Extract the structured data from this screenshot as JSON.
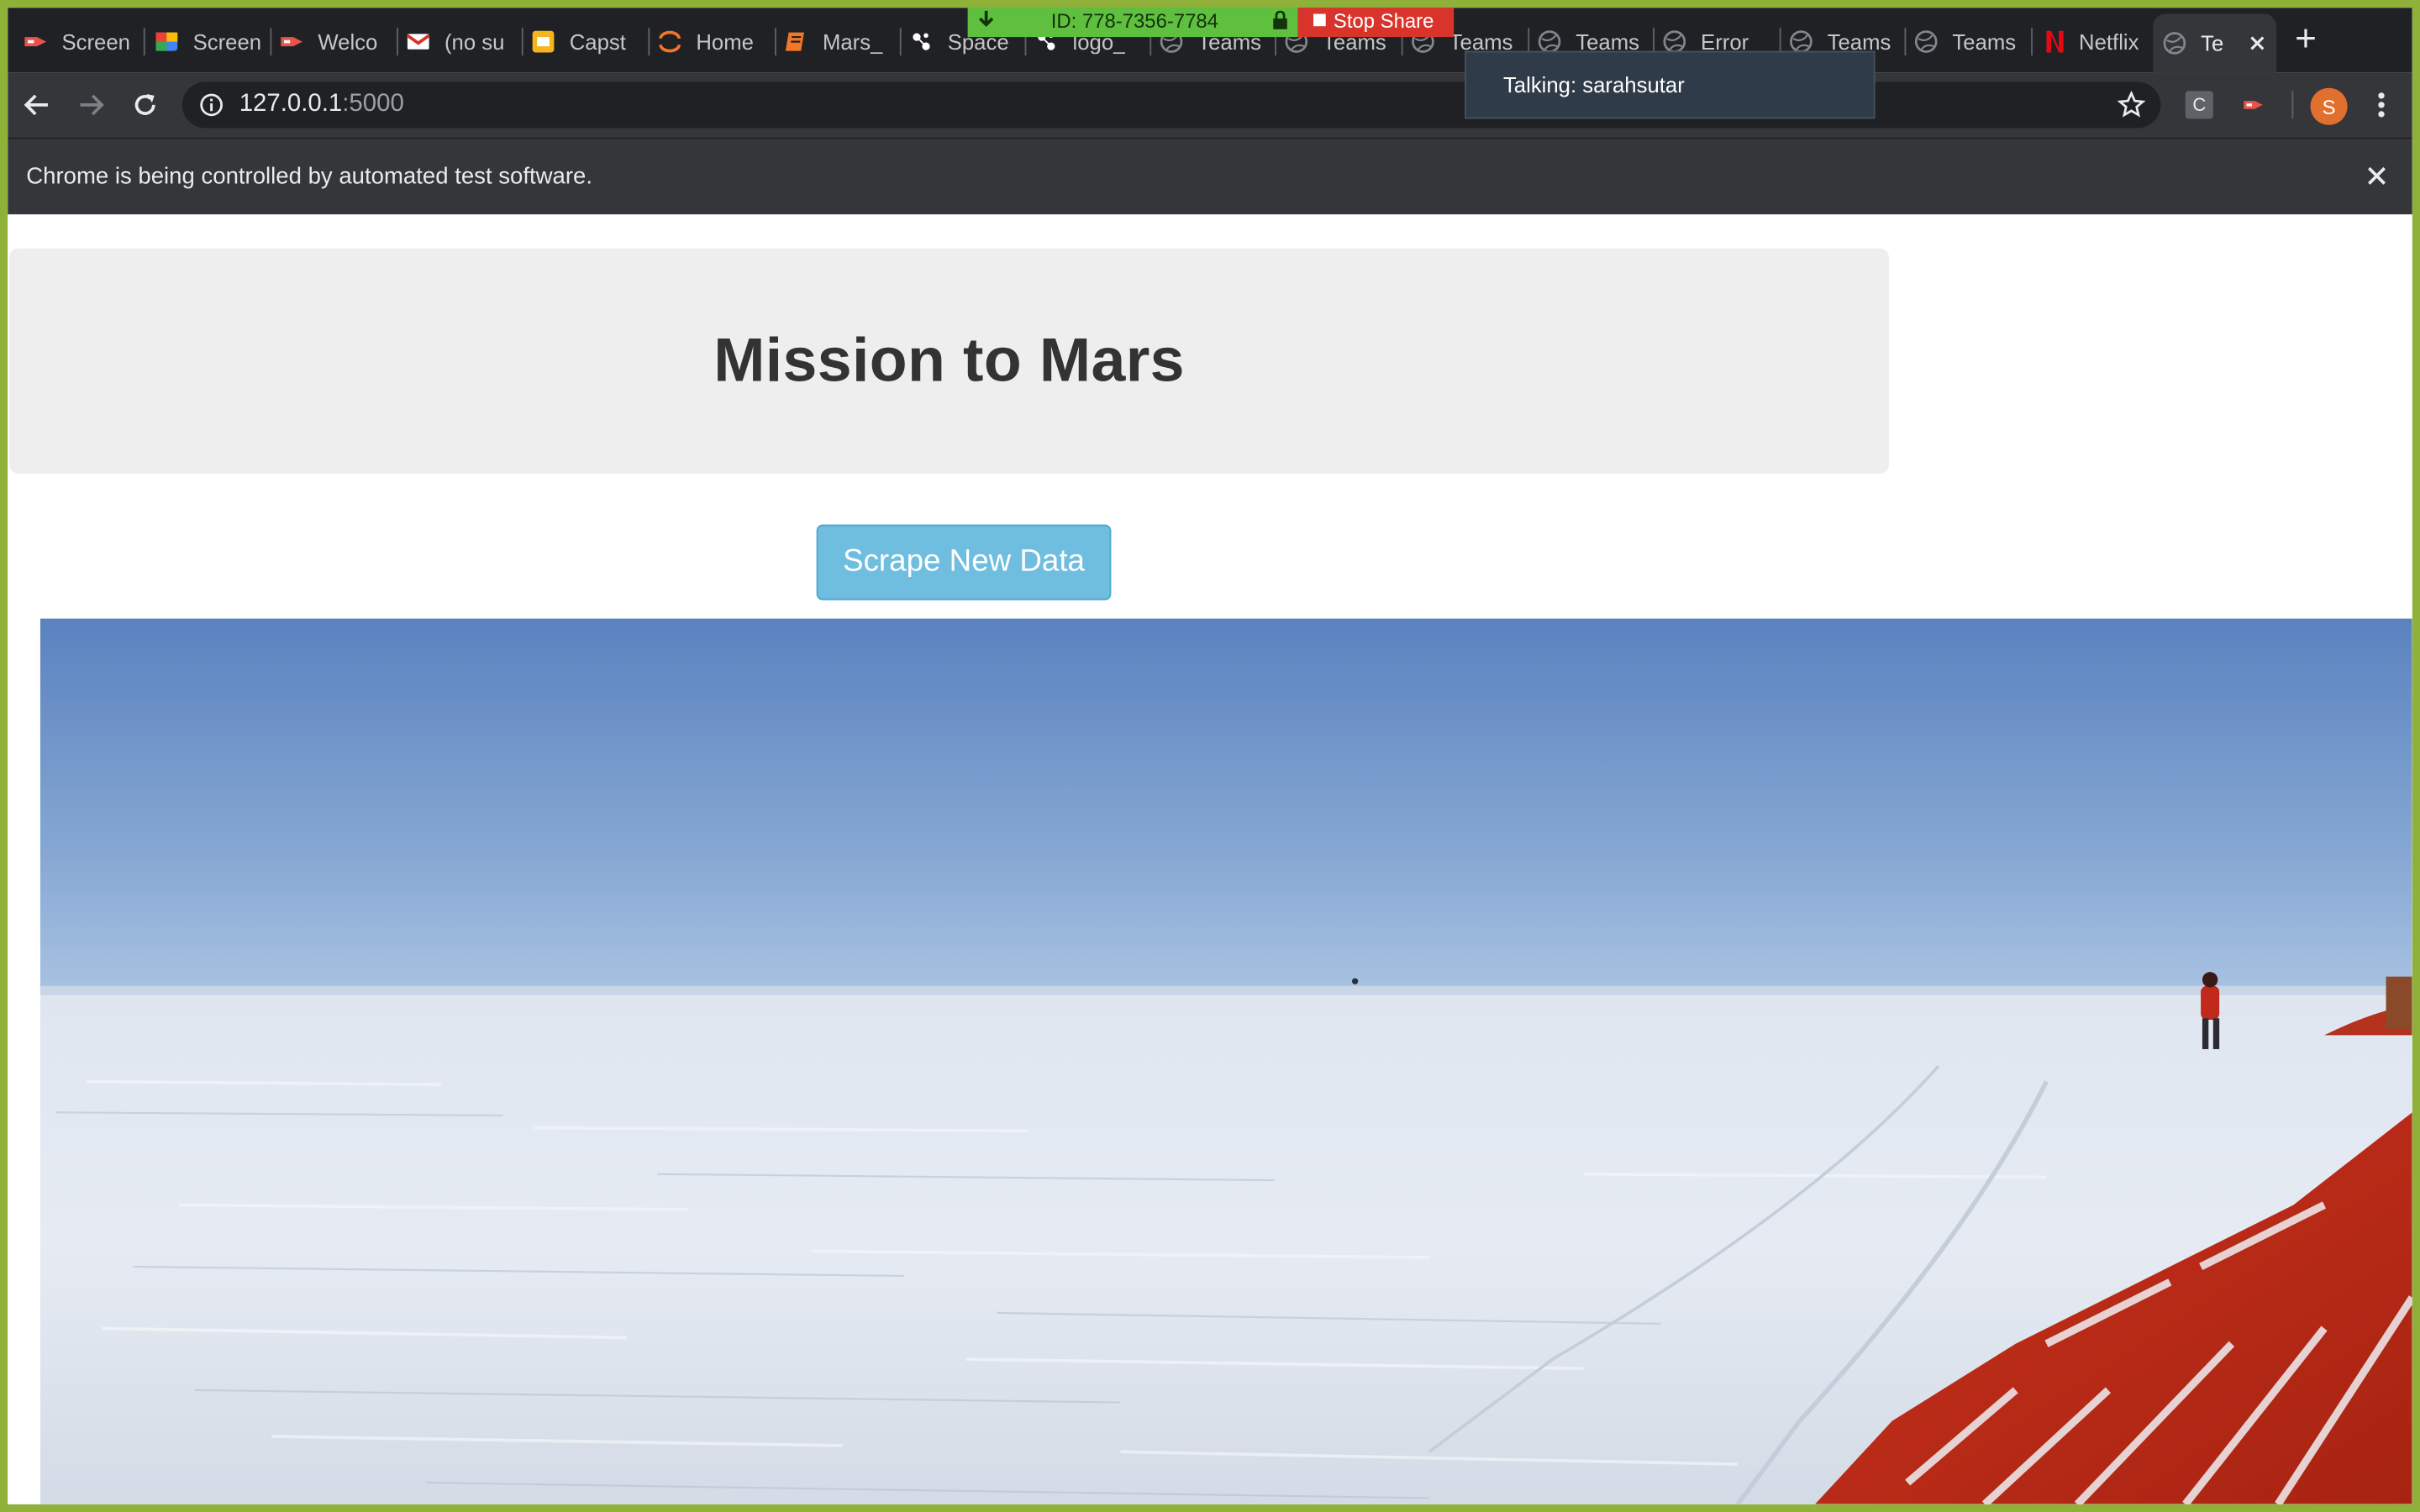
{
  "browser": {
    "tabs": [
      {
        "label": "Screen",
        "icon": "screencastify-icon",
        "color": "#e8534a"
      },
      {
        "label": "Screen",
        "icon": "drive-icon",
        "color": "#f4b400"
      },
      {
        "label": "Welco",
        "icon": "screencastify-icon",
        "color": "#e8534a"
      },
      {
        "label": "(no su",
        "icon": "gmail-icon",
        "color": "#d93025"
      },
      {
        "label": "Capst",
        "icon": "slides-icon",
        "color": "#f6b51e"
      },
      {
        "label": "Home",
        "icon": "jupyter-icon",
        "color": "#f37726"
      },
      {
        "label": "Mars_",
        "icon": "notebook-icon",
        "color": "#f37726"
      },
      {
        "label": "Space",
        "icon": "space-icon",
        "color": "#ffffff"
      },
      {
        "label": "logo_",
        "icon": "space-icon",
        "color": "#ffffff"
      },
      {
        "label": "Teams",
        "icon": "globe-icon",
        "color": "#5f6368"
      },
      {
        "label": "Teams",
        "icon": "globe-icon",
        "color": "#5f6368"
      },
      {
        "label": "Teams",
        "icon": "globe-icon",
        "color": "#5f6368"
      },
      {
        "label": "Teams",
        "icon": "globe-icon",
        "color": "#5f6368"
      },
      {
        "label": "Error",
        "icon": "globe-icon",
        "color": "#5f6368"
      },
      {
        "label": "Teams",
        "icon": "globe-icon",
        "color": "#5f6368"
      },
      {
        "label": "Teams",
        "icon": "globe-icon",
        "color": "#5f6368"
      },
      {
        "label": "Netflix",
        "icon": "netflix-icon",
        "color": "#e50914"
      },
      {
        "label": "Te",
        "icon": "globe-icon",
        "color": "#5f6368",
        "active": true
      }
    ],
    "new_tab_label": "+",
    "url_host": "127.0.0.1",
    "url_port": ":5000",
    "extension_label": "C",
    "avatar_initial": "S",
    "infobar_text": "Chrome is being controlled by automated test software."
  },
  "share": {
    "meeting_id": "ID: 778-7356-7784",
    "stop_label": "Stop Share",
    "talking": "Talking: sarahsutar"
  },
  "page": {
    "title": "Mission to Mars",
    "scrape_button": "Scrape New Data",
    "hero_image": "antarctic-snow-field-photo"
  },
  "colors": {
    "frame": "#8fb13a",
    "button": "#6fbedf",
    "jumbotron": "#eeeeee"
  }
}
